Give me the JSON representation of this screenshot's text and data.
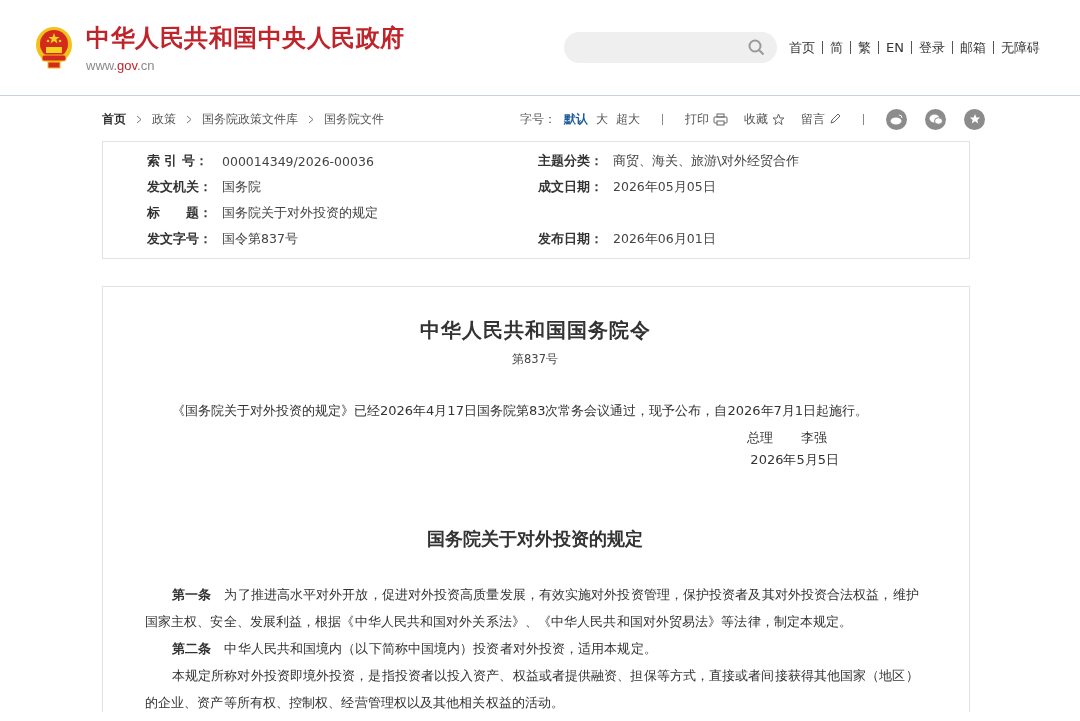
{
  "header": {
    "site_title": "中华人民共和国中央人民政府",
    "domain_parts": [
      {
        "text": "www.",
        "highlight": false
      },
      {
        "text": "gov",
        "highlight": true
      },
      {
        "text": ".cn",
        "highlight": false
      }
    ],
    "nav": [
      "首页",
      "简",
      "繁",
      "EN",
      "登录",
      "邮箱",
      "无障碍"
    ]
  },
  "breadcrumb": [
    "首页",
    "政策",
    "国务院政策文件库",
    "国务院文件"
  ],
  "font_size": {
    "label": "字号：",
    "options": [
      {
        "label": "默认",
        "selected": true
      },
      {
        "label": "大",
        "selected": false
      },
      {
        "label": "超大",
        "selected": false
      }
    ]
  },
  "actions": [
    {
      "label": "打印",
      "kind": "print"
    },
    {
      "label": "收藏",
      "kind": "star"
    },
    {
      "label": "留言",
      "kind": "pencil"
    }
  ],
  "share": [
    {
      "kind": "weibo"
    },
    {
      "kind": "wechat"
    },
    {
      "kind": "favorite"
    }
  ],
  "meta": [
    {
      "cells": [
        {
          "label": "索 引 号：",
          "value": "000014349/2026-00036"
        },
        {
          "label": "主题分类：",
          "value": "商贸、海关、旅游\\对外经贸合作"
        }
      ]
    },
    {
      "cells": [
        {
          "label": "发文机关：",
          "value": "国务院"
        },
        {
          "label": "成文日期：",
          "value": "2026年05月05日"
        }
      ]
    },
    {
      "cells": [
        {
          "label": "标　　题：",
          "value": "国务院关于对外投资的规定"
        }
      ]
    },
    {
      "cells": [
        {
          "label": "发文字号：",
          "value": "国令第837号"
        },
        {
          "label": "发布日期：",
          "value": "2026年06月01日"
        }
      ]
    }
  ],
  "document": {
    "order_title": "中华人民共和国国务院令",
    "order_number": "第837号",
    "promulgation": "《国务院关于对外投资的规定》已经2026年4月17日国务院第83次常务会议通过，现予公布，自2026年7月1日起施行。",
    "signer_title": "总理",
    "signer": "李强",
    "date": "2026年5月5日",
    "regulation_title": "国务院关于对外投资的规定",
    "paragraphs": [
      "**第一条**　为了推进高水平对外开放，促进对外投资高质量发展，有效实施对外投资管理，保护投资者及其对外投资合法权益，维护国家主权、安全、发展利益，根据《中华人民共和国对外关系法》、《中华人民共和国对外贸易法》等法律，制定本规定。",
      "**第二条**　中华人民共和国境内（以下简称中国境内）投资者对外投资，适用本规定。",
      "本规定所称对外投资即境外投资，是指投资者以投入资产、权益或者提供融资、担保等方式，直接或者间接获得其他国家（地区）的企业、资产等所有权、控制权、经营管理权以及其他相关权益的活动。"
    ]
  }
}
